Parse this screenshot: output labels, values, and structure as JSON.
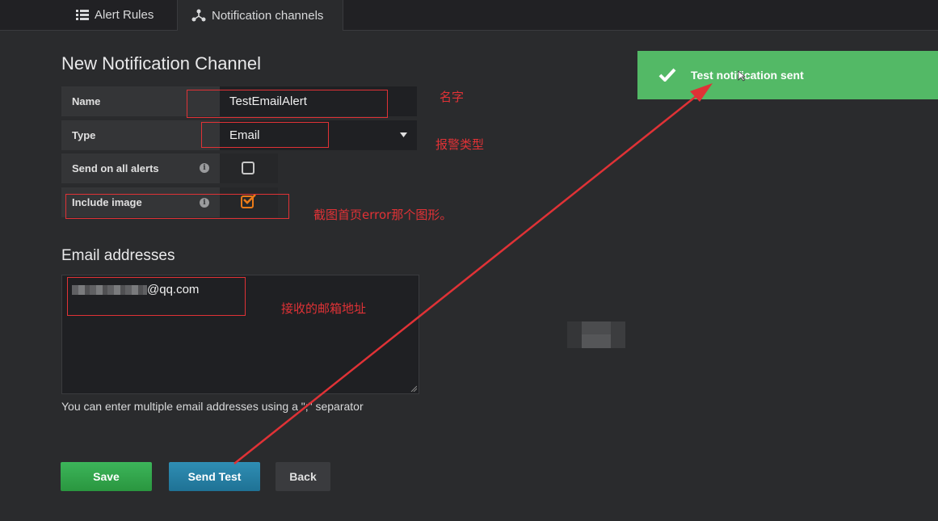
{
  "tabs": [
    {
      "label": "Alert Rules",
      "icon": "list-icon",
      "active": false
    },
    {
      "label": "Notification channels",
      "icon": "share-nodes-icon",
      "active": true
    }
  ],
  "form": {
    "title": "New Notification Channel",
    "name_label": "Name",
    "name_value": "TestEmailAlert",
    "type_label": "Type",
    "type_value": "Email",
    "send_all_label": "Send on all alerts",
    "send_all_checked": false,
    "include_image_label": "Include image",
    "include_image_checked": true
  },
  "email": {
    "section_title": "Email addresses",
    "value_suffix": "@qq.com",
    "help": "You can enter multiple email addresses using a \";\" separator"
  },
  "buttons": {
    "save": "Save",
    "send_test": "Send Test",
    "back": "Back"
  },
  "toast": {
    "message": "Test notification sent"
  },
  "annotations": {
    "name": "名字",
    "type": "报警类型",
    "image": "截图首页error那个图形。",
    "email": "接收的邮箱地址"
  },
  "colors": {
    "annotation": "#e03236",
    "toast": "#53b966",
    "save": "#2a963f",
    "send_test": "#1f7295",
    "checked": "#eb7b18"
  }
}
